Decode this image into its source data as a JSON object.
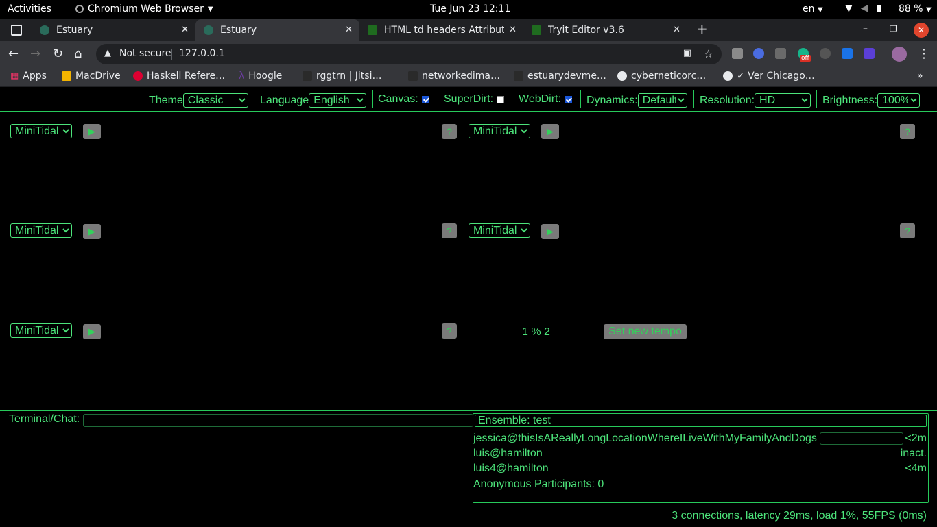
{
  "os": {
    "activities": "Activities",
    "app_name": "Chromium Web Browser",
    "clock": "Tue Jun 23  12:11",
    "lang": "en",
    "battery": "88 %"
  },
  "tabs": [
    {
      "title": "Estuary",
      "close": "✕"
    },
    {
      "title": "Estuary",
      "close": "✕"
    },
    {
      "title": "HTML td headers Attribut",
      "close": "✕"
    },
    {
      "title": "Tryit Editor v3.6",
      "close": "✕"
    }
  ],
  "window": {
    "new_tab": "+",
    "minimize": "–",
    "restore": "❐",
    "close": "✕"
  },
  "toolbar": {
    "not_secure": "Not secure",
    "url": "127.0.0.1",
    "ext_badge": "off"
  },
  "bookmarks": [
    "Apps",
    "MacDrive",
    "Haskell Refere…",
    "Hoogle",
    "rggtrn | Jitsi…",
    "networkedima…",
    "estuarydevme…",
    "cyberneticorc…",
    "✓ Ver Chicago…"
  ],
  "bookmarks_more": "»",
  "nav": {
    "theme_label": "Theme",
    "theme_value": "Classic",
    "language_label": "Language",
    "language_value": "English",
    "canvas_label": "Canvas:",
    "canvas_checked": true,
    "superdirt_label": "SuperDirt:",
    "superdirt_checked": false,
    "webdirt_label": "WebDirt:",
    "webdirt_checked": true,
    "dynamics_label": "Dynamics:",
    "dynamics_value": "Default",
    "resolution_label": "Resolution:",
    "resolution_value": "HD",
    "brightness_label": "Brightness:",
    "brightness_value": "100%"
  },
  "cells": [
    {
      "language": "MiniTidal",
      "play": "▶",
      "help": "?"
    },
    {
      "language": "MiniTidal",
      "play": "▶",
      "help": "?"
    },
    {
      "language": "MiniTidal",
      "play": "▶",
      "help": "?"
    },
    {
      "language": "MiniTidal",
      "play": "▶",
      "help": "?"
    },
    {
      "language": "MiniTidal",
      "play": "▶",
      "help": "?"
    }
  ],
  "tempo": {
    "display": "1 % 2",
    "button": "Set new tempo"
  },
  "terminal": {
    "label": "Terminal/Chat:"
  },
  "ensemble": {
    "title": "Ensemble: test",
    "participants": [
      {
        "name": "jessica@thisIsAReallyLongLocationWhereILiveWithMyFamilyAndDogs",
        "status": "<2m"
      },
      {
        "name": "luis@hamilton",
        "status": "inact."
      },
      {
        "name": "luis4@hamilton",
        "status": "<4m"
      }
    ],
    "anonymous": "Anonymous Participants: 0"
  },
  "status": "3 connections, latency 29ms, load 1%, 55FPS (0ms)",
  "colors": {
    "accent": "#4ce37a",
    "button_bg": "#7a7a7a",
    "browser_chrome": "#35363a"
  }
}
